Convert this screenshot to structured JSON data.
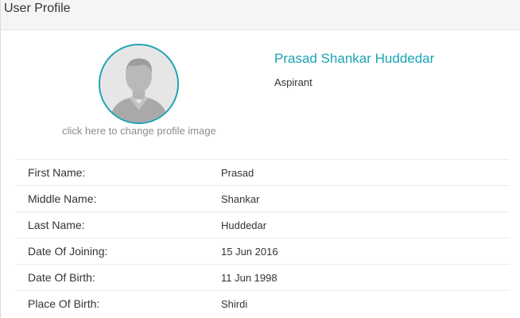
{
  "header": {
    "title": "User Profile"
  },
  "profile": {
    "change_image_text": "click here to change profile image",
    "full_name": "Prasad Shankar Huddedar",
    "role": "Aspirant",
    "accent_color": "#1aa3b5",
    "avatar_icon": "default-user-avatar-icon"
  },
  "details": [
    {
      "label": "First Name:",
      "value": "Prasad"
    },
    {
      "label": "Middle Name:",
      "value": "Shankar"
    },
    {
      "label": "Last Name:",
      "value": "Huddedar"
    },
    {
      "label": "Date Of Joining:",
      "value": "15 Jun 2016"
    },
    {
      "label": "Date Of Birth:",
      "value": "11 Jun 1998"
    },
    {
      "label": "Place Of Birth:",
      "value": "Shirdi"
    }
  ]
}
